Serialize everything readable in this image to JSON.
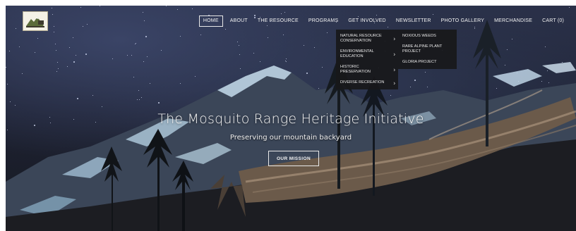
{
  "header": {
    "logo_icon": "mrhi-logo-icon",
    "nav": [
      {
        "label": "HOME",
        "active": true
      },
      {
        "label": "ABOUT"
      },
      {
        "label": "THE RESOURCE"
      },
      {
        "label": "PROGRAMS"
      },
      {
        "label": "GET INVOLVED"
      },
      {
        "label": "NEWSLETTER"
      },
      {
        "label": "PHOTO GALLERY"
      },
      {
        "label": "MERCHANDISE"
      },
      {
        "label": "CART (0)"
      }
    ]
  },
  "dropdown": {
    "items": [
      {
        "label": "Natural Resource Conservation"
      },
      {
        "label": "Environmental Education"
      },
      {
        "label": "Historic Preservation"
      },
      {
        "label": "Diverse Recreation"
      }
    ],
    "submenu": [
      {
        "label": "Noxious Weeds"
      },
      {
        "label": "Rare Alpine Plant Project"
      },
      {
        "label": "Gloria Project"
      }
    ]
  },
  "hero": {
    "title": "The Mosquito Range Heritage Initiative",
    "subtitle": "Preserving our mountain backyard",
    "cta_label": "OUR MISSION"
  },
  "colors": {
    "sky": "#1e2233",
    "snow": "#b9d6e8",
    "menu_bg": "#18181a",
    "text": "#f2f2f2"
  }
}
